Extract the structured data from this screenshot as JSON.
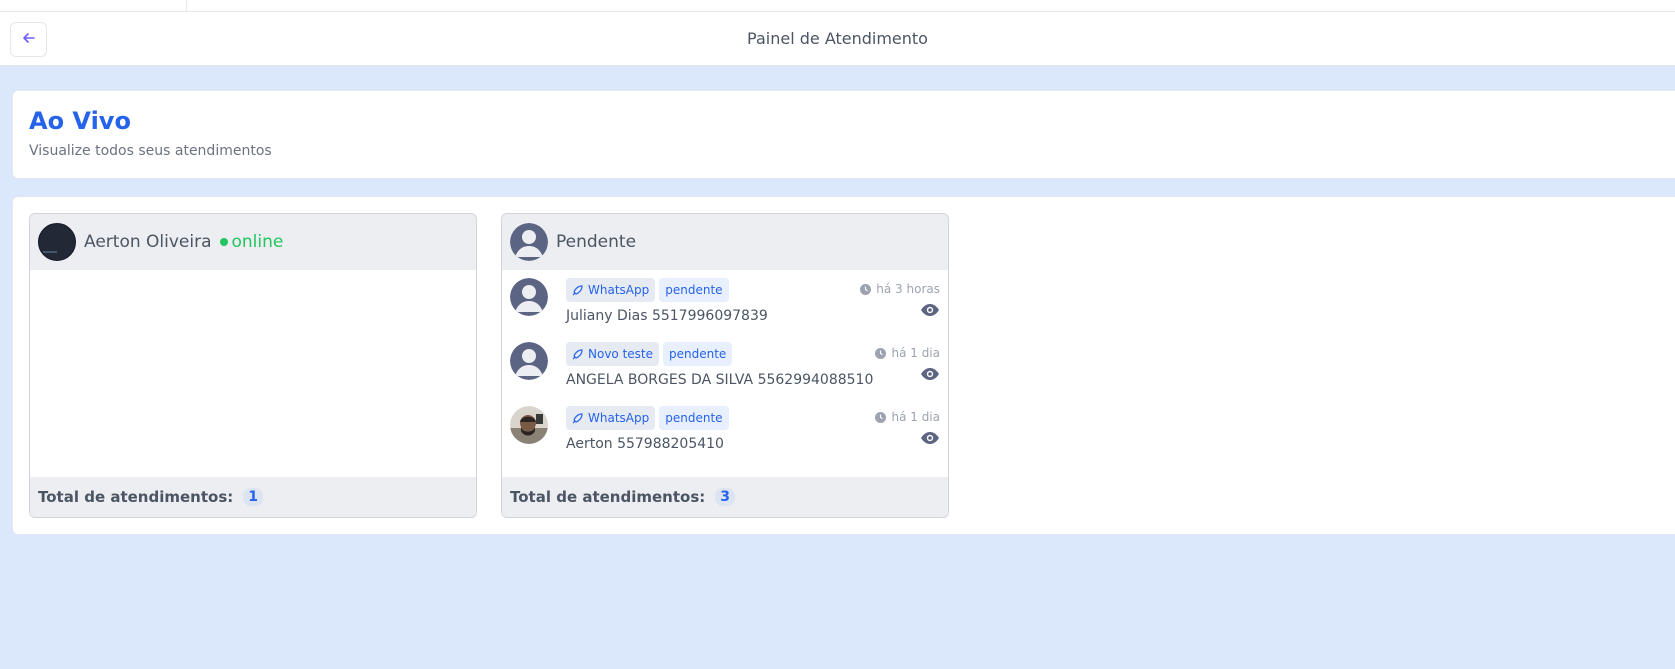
{
  "toolbar": {
    "title": "Painel de Atendimento",
    "back_icon": "arrow-left-icon"
  },
  "header": {
    "title": "Ao Vivo",
    "subtitle": "Visualize todos seus atendimentos"
  },
  "columns": [
    {
      "name": "Aerton Oliveira",
      "status": "online",
      "footer_label": "Total de atendimentos:",
      "count": "1",
      "tickets": []
    },
    {
      "name": "Pendente",
      "footer_label": "Total de atendimentos:",
      "count": "3",
      "tickets": [
        {
          "channel": "WhatsApp",
          "status": "pendente",
          "time": "há 3 horas",
          "contact": "Juliany Dias 5517996097839",
          "avatar": "default"
        },
        {
          "channel": "Novo teste",
          "status": "pendente",
          "time": "há 1 dia",
          "contact": "ANGELA BORGES DA SILVA 5562994088510",
          "avatar": "default"
        },
        {
          "channel": "WhatsApp",
          "status": "pendente",
          "time": "há 1 dia",
          "contact": "Aerton 557988205410",
          "avatar": "photo"
        }
      ]
    }
  ],
  "colors": {
    "accent": "#2563eb",
    "online": "#22c55e",
    "background": "#dbe8fc"
  }
}
